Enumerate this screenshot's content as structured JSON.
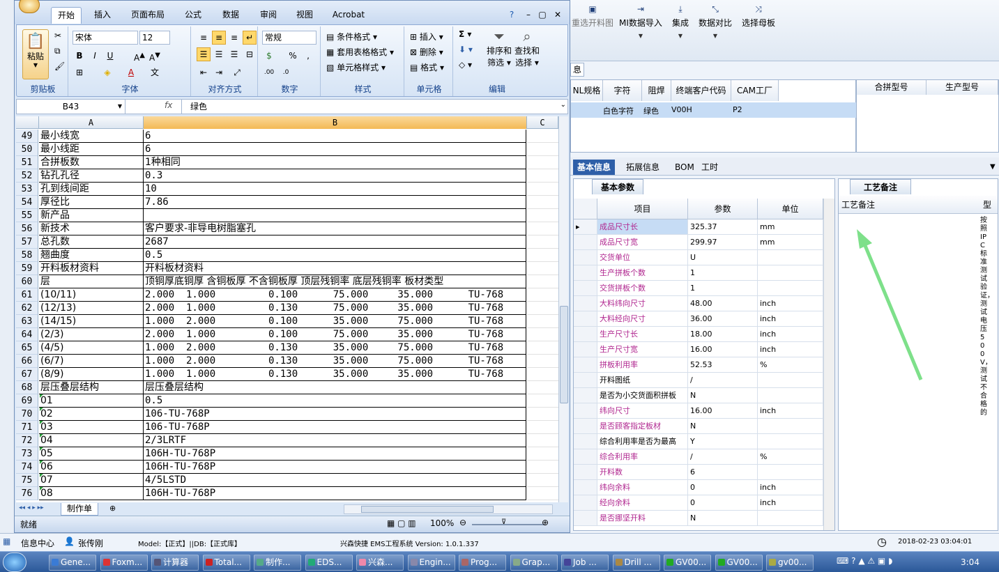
{
  "bg_app": {
    "toolbar": [
      {
        "label": "重选开料图",
        "icon": "image-icon",
        "dropdown": false
      },
      {
        "label": "MI数据导入",
        "icon": "import-icon",
        "dropdown": true
      },
      {
        "label": "集成",
        "icon": "download-icon",
        "dropdown": true
      },
      {
        "label": "数据对比",
        "icon": "compare-icon",
        "dropdown": true
      },
      {
        "label": "选择母板",
        "icon": "shuffle-icon",
        "dropdown": false
      }
    ],
    "collapsed_tab": "息",
    "grid1": {
      "headers": [
        "NL规格",
        "字符",
        "阻焊",
        "终端客户代码",
        "CAM工厂"
      ],
      "row": [
        "",
        "白色字符",
        "绿色",
        "V00H",
        "P2"
      ]
    },
    "grid2_headers": [
      "合拼型号",
      "生产型号"
    ],
    "tabs": [
      "基本信息",
      "拓展信息",
      "BOM",
      "工时"
    ],
    "params_tab": "基本参数",
    "params_headers": [
      "项目",
      "参数",
      "单位"
    ],
    "params": [
      {
        "item": "成品尺寸长",
        "value": "325.37",
        "unit": "mm",
        "purple": true
      },
      {
        "item": "成品尺寸宽",
        "value": "299.97",
        "unit": "mm",
        "purple": true
      },
      {
        "item": "交货单位",
        "value": "U",
        "unit": "",
        "purple": true
      },
      {
        "item": "生产拼板个数",
        "value": "1",
        "unit": "",
        "purple": true
      },
      {
        "item": "交货拼板个数",
        "value": "1",
        "unit": "",
        "purple": true
      },
      {
        "item": "大料纬向尺寸",
        "value": "48.00",
        "unit": "inch",
        "purple": true
      },
      {
        "item": "大料经向尺寸",
        "value": "36.00",
        "unit": "inch",
        "purple": true
      },
      {
        "item": "生产尺寸长",
        "value": "18.00",
        "unit": "inch",
        "purple": true
      },
      {
        "item": "生产尺寸宽",
        "value": "16.00",
        "unit": "inch",
        "purple": true
      },
      {
        "item": "拼板利用率",
        "value": "52.53",
        "unit": "%",
        "purple": true
      },
      {
        "item": "开料图纸",
        "value": "/",
        "unit": "",
        "purple": false
      },
      {
        "item": "是否为小交货面积拼板",
        "value": "N",
        "unit": "",
        "purple": false
      },
      {
        "item": "纬向尺寸",
        "value": "16.00",
        "unit": "inch",
        "purple": true
      },
      {
        "item": "是否顾客指定板材",
        "value": "N",
        "unit": "",
        "purple": true
      },
      {
        "item": "综合利用率是否为最高",
        "value": "Y",
        "unit": "",
        "purple": false
      },
      {
        "item": "综合利用率",
        "value": "/",
        "unit": "%",
        "purple": true
      },
      {
        "item": "开料数",
        "value": "6",
        "unit": "",
        "purple": true
      },
      {
        "item": "纬向余料",
        "value": "0",
        "unit": "inch",
        "purple": true
      },
      {
        "item": "经向余料",
        "value": "0",
        "unit": "inch",
        "purple": true
      },
      {
        "item": "是否挪坚开料",
        "value": "N",
        "unit": "",
        "purple": true
      }
    ],
    "notes_tab": "工艺备注",
    "notes_header": "工艺备注",
    "side_header": "型",
    "side_text": "按照IPC标准测试验证，测试电压500V，测试不合格的"
  },
  "excel": {
    "tabs": [
      "开始",
      "插入",
      "页面布局",
      "公式",
      "数据",
      "审阅",
      "视图",
      "Acrobat"
    ],
    "active_tab": "开始",
    "groups": {
      "clipboard": "剪贴板",
      "font": "字体",
      "align": "对齐方式",
      "number": "数字",
      "style": "样式",
      "cells": "单元格",
      "edit": "编辑"
    },
    "paste": "粘贴",
    "font_name": "宋体",
    "font_size": "12",
    "number_format": "常规",
    "style_items": [
      "条件格式",
      "套用表格格式",
      "单元格样式"
    ],
    "cell_items": [
      "插入",
      "删除",
      "格式"
    ],
    "edit_items": [
      "排序和\n筛选",
      "查找和\n选择"
    ],
    "sort_label1": "排序和",
    "sort_label2": "筛选",
    "find_label1": "查找和",
    "find_label2": "选择",
    "namebox": "B43",
    "fx": "fx",
    "formula": "绿色",
    "col_a": "A",
    "col_b": "B",
    "col_c": "C",
    "rows": [
      {
        "n": "49",
        "a": "最小线宽",
        "b": "6",
        "green": false
      },
      {
        "n": "50",
        "a": "最小线距",
        "b": "6",
        "green": false
      },
      {
        "n": "51",
        "a": "合拼板数",
        "b": "1种相同",
        "green": false
      },
      {
        "n": "52",
        "a": "钻孔孔径",
        "b": "0.3",
        "green": false
      },
      {
        "n": "53",
        "a": "孔到线间距",
        "b": "10",
        "green": false
      },
      {
        "n": "54",
        "a": "厚径比",
        "b": "7.86",
        "green": false
      },
      {
        "n": "55",
        "a": "新产品",
        "b": "",
        "green": false
      },
      {
        "n": "56",
        "a": "新技术",
        "b": "客户要求-非导电树脂塞孔",
        "green": false
      },
      {
        "n": "57",
        "a": "总孔数",
        "b": "2687",
        "green": false
      },
      {
        "n": "58",
        "a": "翘曲度",
        "b": "0.5",
        "green": false
      },
      {
        "n": "59",
        "a": "开料板材资料",
        "b": "开料板材资料",
        "green": false
      },
      {
        "n": "60",
        "a": "层",
        "b": "顶铜厚底铜厚 含铜板厚 不含铜板厚 顶层残铜率 底层残铜率 板材类型",
        "green": false
      },
      {
        "n": "61",
        "a": "(10/11)",
        "b": "2.000  1.000         0.100      75.000     35.000      TU-768",
        "green": false
      },
      {
        "n": "62",
        "a": "(12/13)",
        "b": "2.000  1.000         0.130      75.000     35.000      TU-768",
        "green": false
      },
      {
        "n": "63",
        "a": "(14/15)",
        "b": "1.000  2.000         0.100      35.000     75.000      TU-768",
        "green": false
      },
      {
        "n": "64",
        "a": "(2/3)",
        "b": "2.000  1.000         0.100      75.000     35.000      TU-768",
        "green": false
      },
      {
        "n": "65",
        "a": "(4/5)",
        "b": "1.000  2.000         0.130      35.000     75.000      TU-768",
        "green": false
      },
      {
        "n": "66",
        "a": "(6/7)",
        "b": "1.000  2.000         0.130      35.000     75.000      TU-768",
        "green": false
      },
      {
        "n": "67",
        "a": "(8/9)",
        "b": "1.000  1.000         0.130      35.000     35.000      TU-768",
        "green": false
      },
      {
        "n": "68",
        "a": "层压叠层结构",
        "b": "层压叠层结构",
        "green": false
      },
      {
        "n": "69",
        "a": "01",
        "b": "0.5",
        "green": true
      },
      {
        "n": "70",
        "a": "02",
        "b": "106-TU-768P",
        "green": true
      },
      {
        "n": "71",
        "a": "03",
        "b": "106-TU-768P",
        "green": true
      },
      {
        "n": "72",
        "a": "04",
        "b": "2/3LRTF",
        "green": true
      },
      {
        "n": "73",
        "a": "05",
        "b": "106H-TU-768P",
        "green": true
      },
      {
        "n": "74",
        "a": "06",
        "b": "106H-TU-768P",
        "green": true
      },
      {
        "n": "75",
        "a": "07",
        "b": "4/5LSTD",
        "green": true
      },
      {
        "n": "76",
        "a": "08",
        "b": "106H-TU-768P",
        "green": true
      }
    ],
    "sheet_tab": "制作单",
    "status": "就绪",
    "zoom": "100%"
  },
  "app_status": {
    "info_center": "信息中心",
    "user": "张传刚",
    "model": "Model:【正式】||DB:【正式库】",
    "system": "兴森快捷 EMS工程系统 Version: 1.0.1.337",
    "datetime": "2018-02-23 03:04:01"
  },
  "taskbar": {
    "items": [
      "Gene...",
      "Foxm...",
      "计算器",
      "Total...",
      "制作...",
      "EDS...",
      "兴森...",
      "Engin...",
      "Prog...",
      "Grap...",
      "Job ...",
      "Drill ...",
      "GV00...",
      "GV00...",
      "gv00..."
    ],
    "clock": "3:04"
  },
  "colors": {
    "accent": "#2e5fa8",
    "purple": "#b0268f",
    "arrow": "#7ee08a"
  }
}
